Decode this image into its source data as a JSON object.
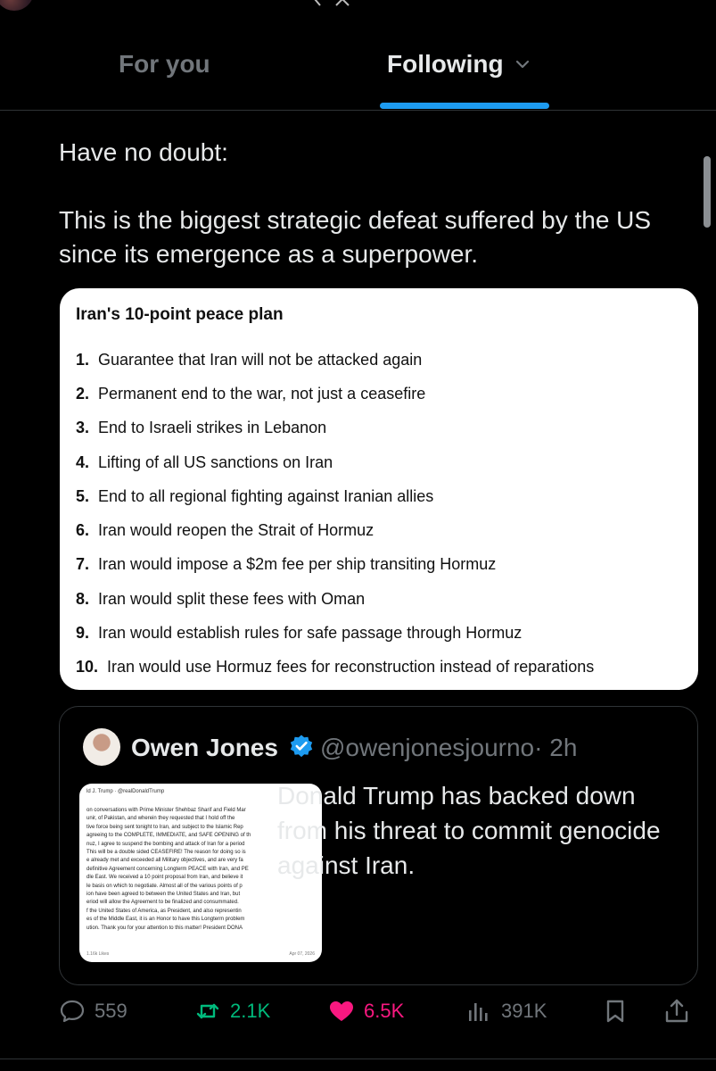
{
  "tabs": [
    {
      "label": "For you",
      "active": false
    },
    {
      "label": "Following",
      "active": true
    }
  ],
  "tweet": {
    "paragraphs": [
      "Have no doubt:",
      "This is the biggest strategic defeat suffered by the US since its emergence as a superpower."
    ]
  },
  "plan": {
    "title": "Iran's 10-point peace plan",
    "items": [
      {
        "num": "1.",
        "text": "Guarantee that Iran will not be attacked again"
      },
      {
        "num": "2.",
        "text": "Permanent end to the war, not just a ceasefire"
      },
      {
        "num": "3.",
        "text": "End to Israeli strikes in Lebanon"
      },
      {
        "num": "4.",
        "text": "Lifting of all US sanctions on Iran"
      },
      {
        "num": "5.",
        "text": "End to all regional fighting against Iranian allies"
      },
      {
        "num": "6.",
        "text": "Iran would reopen the Strait of Hormuz"
      },
      {
        "num": "7.",
        "text": "Iran would impose a $2m fee per ship transiting Hormuz"
      },
      {
        "num": "8.",
        "text": "Iran would split these fees with Oman"
      },
      {
        "num": "9.",
        "text": "Iran would establish rules for safe passage through Hormuz"
      },
      {
        "num": "10.",
        "text": "Iran would use Hormuz fees for reconstruction instead of reparations"
      }
    ]
  },
  "quote": {
    "name": "Owen Jones",
    "handle": "@owenjonesjourno",
    "time": "· 2h",
    "text": "Donald Trump has backed down from his threat to commit genocide against Iran.",
    "thumbnail": {
      "header": "ld J. Trump · @realDonaldTrump",
      "lines": [
        "on conversations with Prime Minister Shehbaz Sharif and Field Mar",
        "unir, of Pakistan, and wherein they requested that I hold off the",
        "tive force being sent tonight to Iran, and subject to the Islamic Rep",
        "agreeing to the COMPLETE, IMMEDIATE, and SAFE OPENING of th",
        "nuz, I agree to suspend the bombing and attack of Iran for a period",
        "This will be a double sided CEASEFIRE! The reason for doing so is",
        "e already met and exceeded all Military objectives, and are very fa",
        "definitive Agreement concerning Longterm PEACE with Iran, and PE",
        "dle East. We received a 10 point proposal from Iran, and believe it",
        "le basis on which to negotiate. Almost all of the various points of p",
        "ion have been agreed to between the United States and Iran, but",
        "eriod will allow the Agreement to be finalized and consummated.",
        "f the United States of America, as President, and also representin",
        "es of the Middle East, it is an Honor to have this Longterm problem",
        "ution. Thank you for your attention to this matter! President DONA"
      ],
      "likes": "1.16k Likes",
      "date": "Apr 07, 2026"
    }
  },
  "actions": {
    "replies": "559",
    "reposts": "2.1K",
    "likes": "6.5K",
    "views": "391K"
  },
  "colors": {
    "accent": "#1d9bf0",
    "repost": "#00ba7c",
    "like": "#f91880",
    "muted": "#71767b",
    "background": "#000000"
  }
}
